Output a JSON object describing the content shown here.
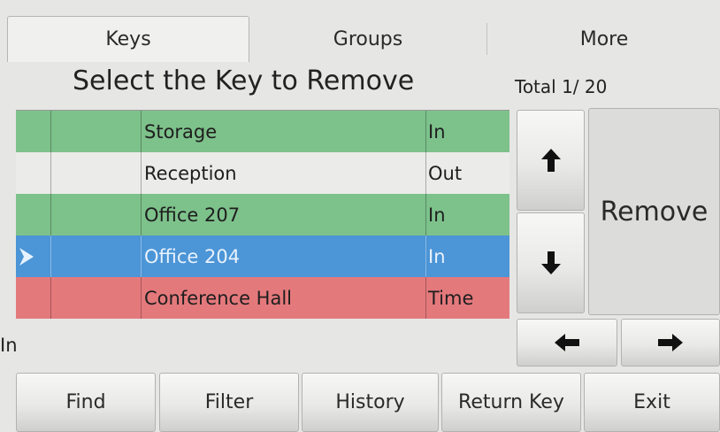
{
  "tabs": [
    {
      "label": "Keys",
      "active": true
    },
    {
      "label": "Groups",
      "active": false
    },
    {
      "label": "More",
      "active": false
    }
  ],
  "heading": "Select the Key to Remove",
  "total": "Total 1/ 20",
  "keys": [
    {
      "name": "Storage",
      "status": "In",
      "color": "#7dc18b"
    },
    {
      "name": "Reception",
      "status": "Out",
      "color": "#ebebe9"
    },
    {
      "name": "Office 207",
      "status": "In",
      "color": "#7dc18b"
    },
    {
      "name": "Office 204",
      "status": "In",
      "color": "#4c95d6",
      "selected": true
    },
    {
      "name": "Conference Hall",
      "status": "Time",
      "color": "#e4797c"
    }
  ],
  "status_label": "In",
  "buttons": {
    "remove": "Remove",
    "scroll_up": "up-arrow-icon",
    "scroll_down": "down-arrow-icon",
    "page_left": "left-arrow-icon",
    "page_right": "right-arrow-icon"
  },
  "bottom_bar": [
    "Find",
    "Filter",
    "History",
    "Return Key",
    "Exit"
  ]
}
